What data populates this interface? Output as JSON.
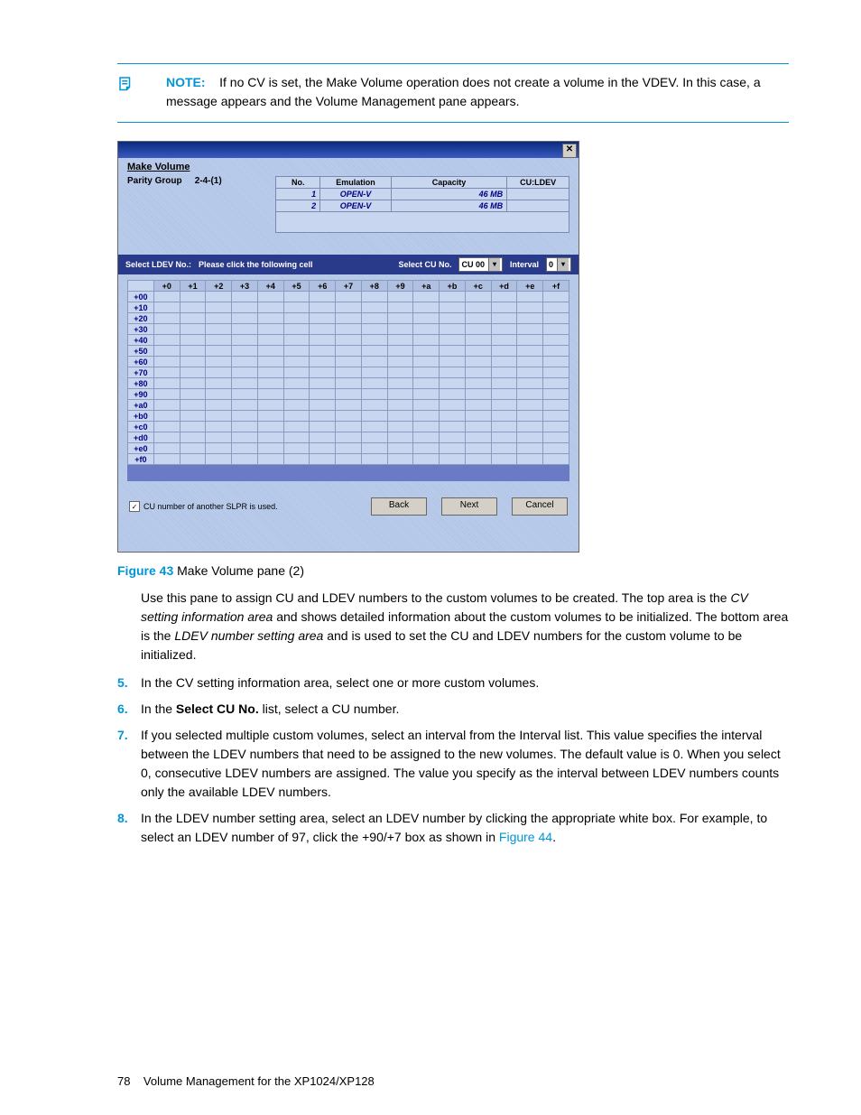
{
  "note": {
    "label": "NOTE:",
    "text": "If no CV is set, the Make Volume operation does not create a volume in the VDEV. In this case, a message appears and the Volume Management pane appears."
  },
  "window": {
    "title": "Make Volume",
    "close": "✕",
    "parity_label": "Parity Group",
    "parity_value": "2-4-(1)",
    "vol_headers": [
      "No.",
      "Emulation",
      "Capacity",
      "CU:LDEV"
    ],
    "vol_rows": [
      {
        "no": "1",
        "emu": "OPEN-V",
        "cap": "46 MB",
        "cl": ""
      },
      {
        "no": "2",
        "emu": "OPEN-V",
        "cap": "46 MB",
        "cl": ""
      }
    ],
    "mid": {
      "select_ldev": "Select LDEV No.:",
      "hint": "Please click the following cell",
      "select_cu": "Select CU No.",
      "cu_val": "CU 00",
      "interval_label": "Interval",
      "interval_val": "0"
    },
    "grid": {
      "cols": [
        "+0",
        "+1",
        "+2",
        "+3",
        "+4",
        "+5",
        "+6",
        "+7",
        "+8",
        "+9",
        "+a",
        "+b",
        "+c",
        "+d",
        "+e",
        "+f"
      ],
      "rows": [
        "+00",
        "+10",
        "+20",
        "+30",
        "+40",
        "+50",
        "+60",
        "+70",
        "+80",
        "+90",
        "+a0",
        "+b0",
        "+c0",
        "+d0",
        "+e0",
        "+f0"
      ]
    },
    "chk_label": "CU number of another SLPR is used.",
    "btn_back": "Back",
    "btn_next": "Next",
    "btn_cancel": "Cancel"
  },
  "figure": {
    "label": "Figure 43",
    "caption": "Make Volume pane (2)"
  },
  "para": {
    "intro_a": "Use this pane to assign CU and LDEV numbers to the custom volumes to be created. The top area is the ",
    "intro_i1": "CV setting information area",
    "intro_b": " and shows detailed information about the custom volumes to be initialized. The bottom area is the ",
    "intro_i2": "LDEV number setting area",
    "intro_c": " and is used to set the CU and LDEV numbers for the custom volume to be initialized."
  },
  "steps": {
    "s5": {
      "n": "5.",
      "t": "In the CV setting information area, select one or more custom volumes."
    },
    "s6": {
      "n": "6.",
      "a": "In the ",
      "b": "Select CU No.",
      "c": " list, select a CU number."
    },
    "s7": {
      "n": "7.",
      "t": "If you selected multiple custom volumes, select an interval from the Interval list. This value specifies the interval between the LDEV numbers that need to be assigned to the new volumes. The default value is 0. When you select 0, consecutive LDEV numbers are assigned. The value you specify as the interval between LDEV numbers counts only the available LDEV numbers."
    },
    "s8": {
      "n": "8.",
      "a": "In the LDEV number setting area, select an LDEV number by clicking the appropriate white box. For example, to select an LDEV number of 97, click the +90/+7 box as shown in ",
      "link": "Figure 44",
      "b": "."
    }
  },
  "footer": {
    "pg": "78",
    "title": "Volume Management for the XP1024/XP128"
  }
}
